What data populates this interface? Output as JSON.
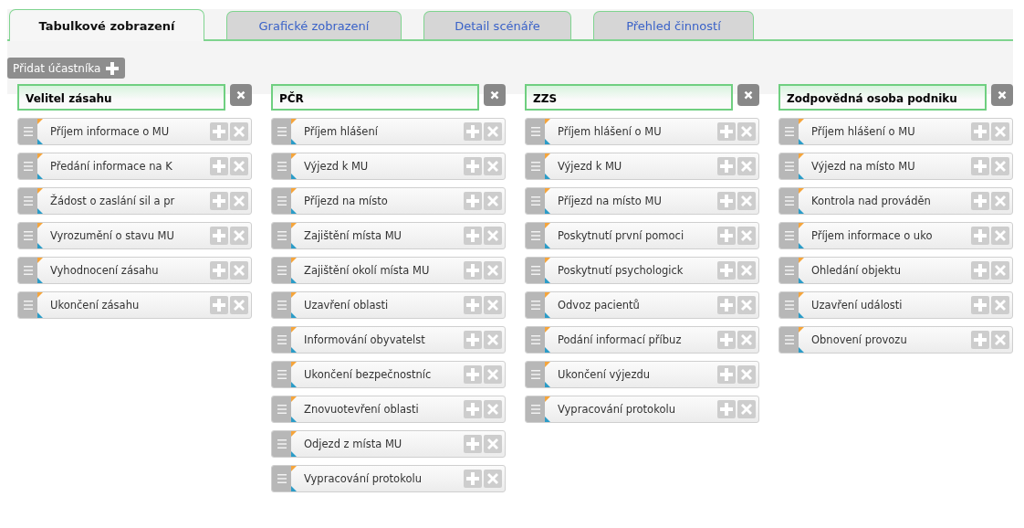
{
  "tabs": [
    {
      "label": "Tabulkové zobrazení",
      "selected": true
    },
    {
      "label": "Grafické zobrazení",
      "selected": false
    },
    {
      "label": "Detail scénáře",
      "selected": false
    },
    {
      "label": "Přehled činností",
      "selected": false
    }
  ],
  "add_button": {
    "label": "Přidat účastníka"
  },
  "participants": [
    {
      "name": "Velitel zásahu",
      "activities": [
        "Příjem informace o MU",
        "Předání informace na K",
        "Žádost o zaslání sil a pr",
        "Vyrozumění o stavu MU",
        "Vyhodnocení zásahu",
        "Ukončení zásahu"
      ]
    },
    {
      "name": "PČR",
      "activities": [
        "Příjem hlášení",
        "Výjezd k MU",
        "Příjezd na místo",
        "Zajištění místa MU",
        "Zajištění okolí místa MU",
        "Uzavření oblasti",
        "Informování obyvatelst",
        "Ukončení bezpečnostníc",
        "Znovuotevření oblasti",
        "Odjezd z místa MU",
        "Vypracování protokolu"
      ]
    },
    {
      "name": "ZZS",
      "activities": [
        "Příjem hlášení o MU",
        "Výjezd k MU",
        "Příjezd na místo MU",
        "Poskytnutí první pomoci",
        "Poskytnutí psychologick",
        "Odvoz pacientů",
        "Podání informací příbuz",
        "Ukončení výjezdu",
        "Vypracování protokolu"
      ]
    },
    {
      "name": "Zodpovědná osoba podniku",
      "activities": [
        "Příjem hlášení o MU",
        "Výjezd na místo MU",
        "Kontrola nad prováděn",
        "Příjem informace o uko",
        "Ohledání objektu",
        "Uzavření události",
        "Obnovení provozu"
      ]
    }
  ]
}
